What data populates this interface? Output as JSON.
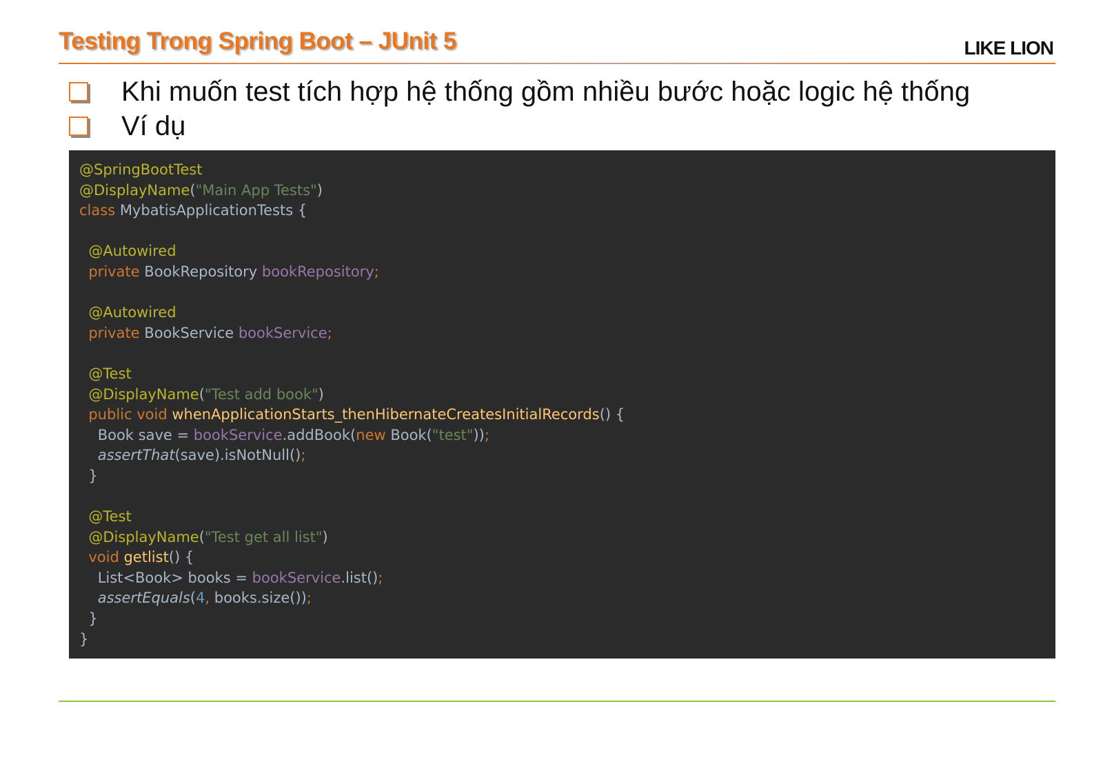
{
  "header": {
    "title": "Testing Trong Spring Boot – JUnit 5",
    "brand": "LIKE LION"
  },
  "bullets": [
    "Khi muốn test tích hợp hệ thống gồm nhiều bước hoặc logic hệ thống",
    "Ví dụ"
  ],
  "colors": {
    "title": "#e87722",
    "bullet_box": "#e87722",
    "footer_rule": "#8cc63f",
    "code_background": "#2b2b2b"
  },
  "code": {
    "language": "java",
    "lines": [
      [
        {
          "t": "@SpringBootTest",
          "k": "annotation"
        }
      ],
      [
        {
          "t": "@DisplayName",
          "k": "annotation"
        },
        {
          "t": "(",
          "k": "plain"
        },
        {
          "t": "\"Main App Tests\"",
          "k": "string"
        },
        {
          "t": ")",
          "k": "plain"
        }
      ],
      [
        {
          "t": "class ",
          "k": "keyword"
        },
        {
          "t": "MybatisApplicationTests {",
          "k": "plain"
        }
      ],
      [],
      [
        {
          "t": "  @Autowired",
          "k": "annotation"
        }
      ],
      [
        {
          "t": "  private ",
          "k": "keyword"
        },
        {
          "t": "BookRepository ",
          "k": "plain"
        },
        {
          "t": "bookRepository",
          "k": "field"
        },
        {
          "t": ";",
          "k": "punct"
        }
      ],
      [],
      [
        {
          "t": "  @Autowired",
          "k": "annotation"
        }
      ],
      [
        {
          "t": "  private ",
          "k": "keyword"
        },
        {
          "t": "BookService ",
          "k": "plain"
        },
        {
          "t": "bookService",
          "k": "field"
        },
        {
          "t": ";",
          "k": "punct"
        }
      ],
      [],
      [
        {
          "t": "  @Test",
          "k": "annotation"
        }
      ],
      [
        {
          "t": "  @DisplayName",
          "k": "annotation"
        },
        {
          "t": "(",
          "k": "plain"
        },
        {
          "t": "\"Test add book\"",
          "k": "string"
        },
        {
          "t": ")",
          "k": "plain"
        }
      ],
      [
        {
          "t": "  public void ",
          "k": "keyword"
        },
        {
          "t": "whenApplicationStarts_thenHibernateCreatesInitialRecords",
          "k": "method"
        },
        {
          "t": "() {",
          "k": "plain"
        }
      ],
      [
        {
          "t": "    Book save = ",
          "k": "plain"
        },
        {
          "t": "bookService",
          "k": "field"
        },
        {
          "t": ".addBook(",
          "k": "plain"
        },
        {
          "t": "new ",
          "k": "keyword"
        },
        {
          "t": "Book(",
          "k": "plain"
        },
        {
          "t": "\"test\"",
          "k": "string"
        },
        {
          "t": "))",
          "k": "plain"
        },
        {
          "t": ";",
          "k": "punct"
        }
      ],
      [
        {
          "t": "    ",
          "k": "plain"
        },
        {
          "t": "assertThat",
          "k": "italic"
        },
        {
          "t": "(save).isNotNull()",
          "k": "plain"
        },
        {
          "t": ";",
          "k": "punct"
        }
      ],
      [
        {
          "t": "  }",
          "k": "plain"
        }
      ],
      [],
      [
        {
          "t": "  @Test",
          "k": "annotation"
        }
      ],
      [
        {
          "t": "  @DisplayName",
          "k": "annotation"
        },
        {
          "t": "(",
          "k": "plain"
        },
        {
          "t": "\"Test get all list\"",
          "k": "string"
        },
        {
          "t": ")",
          "k": "plain"
        }
      ],
      [
        {
          "t": "  void ",
          "k": "keyword"
        },
        {
          "t": "getlist",
          "k": "method"
        },
        {
          "t": "() {",
          "k": "plain"
        }
      ],
      [
        {
          "t": "    List<Book> books = ",
          "k": "plain"
        },
        {
          "t": "bookService",
          "k": "field"
        },
        {
          "t": ".list()",
          "k": "plain"
        },
        {
          "t": ";",
          "k": "punct"
        }
      ],
      [
        {
          "t": "    ",
          "k": "plain"
        },
        {
          "t": "assertEquals",
          "k": "italic"
        },
        {
          "t": "(",
          "k": "plain"
        },
        {
          "t": "4",
          "k": "number"
        },
        {
          "t": ", ",
          "k": "punct"
        },
        {
          "t": "books.size())",
          "k": "plain"
        },
        {
          "t": ";",
          "k": "punct"
        }
      ],
      [
        {
          "t": "  }",
          "k": "plain"
        }
      ],
      [
        {
          "t": "}",
          "k": "plain"
        }
      ]
    ]
  }
}
